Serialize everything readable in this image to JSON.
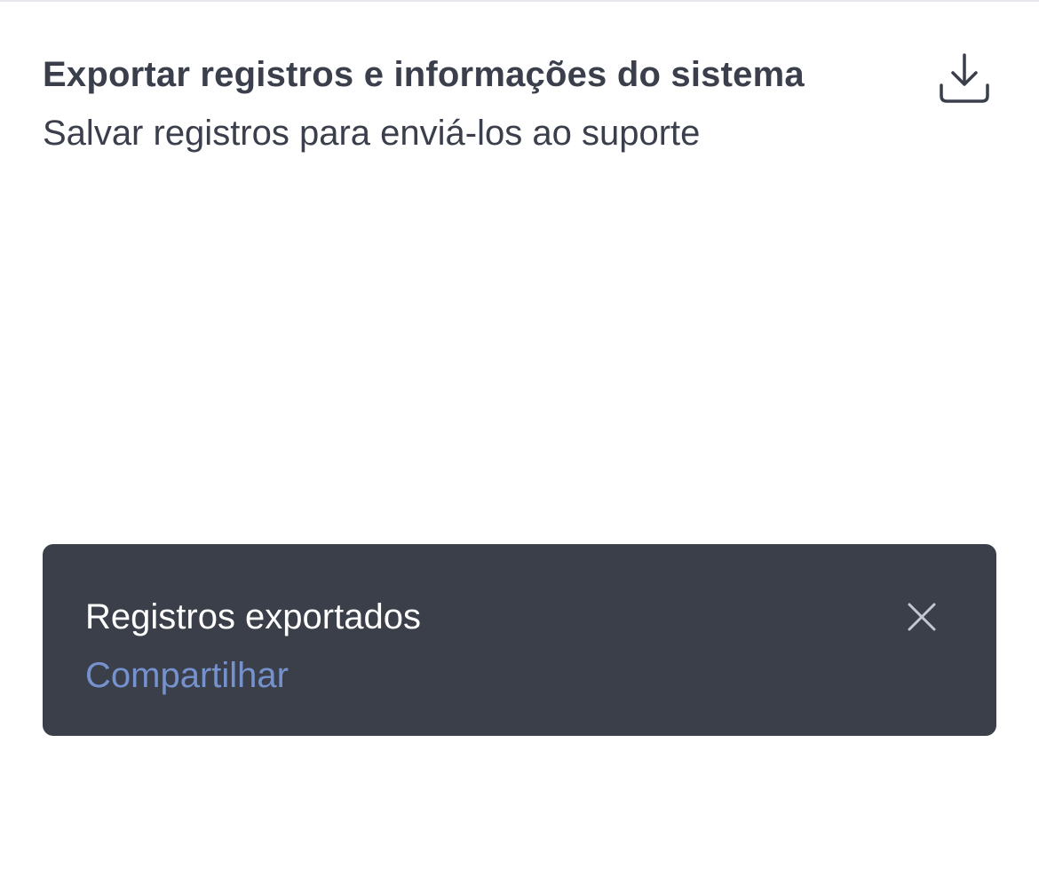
{
  "export_logs": {
    "title": "Exportar registros e informações do sistema",
    "subtitle": "Salvar registros para enviá-los ao suporte",
    "icon": "download-icon"
  },
  "snackbar": {
    "message": "Registros exportados",
    "action_label": "Compartilhar",
    "close_icon": "close-icon"
  },
  "colors": {
    "text_primary": "#3a3f4b",
    "snackbar_background": "#3b3f4a",
    "snackbar_text": "#ffffff",
    "action_link": "#7592cf",
    "close_icon": "#c4c8d0"
  }
}
